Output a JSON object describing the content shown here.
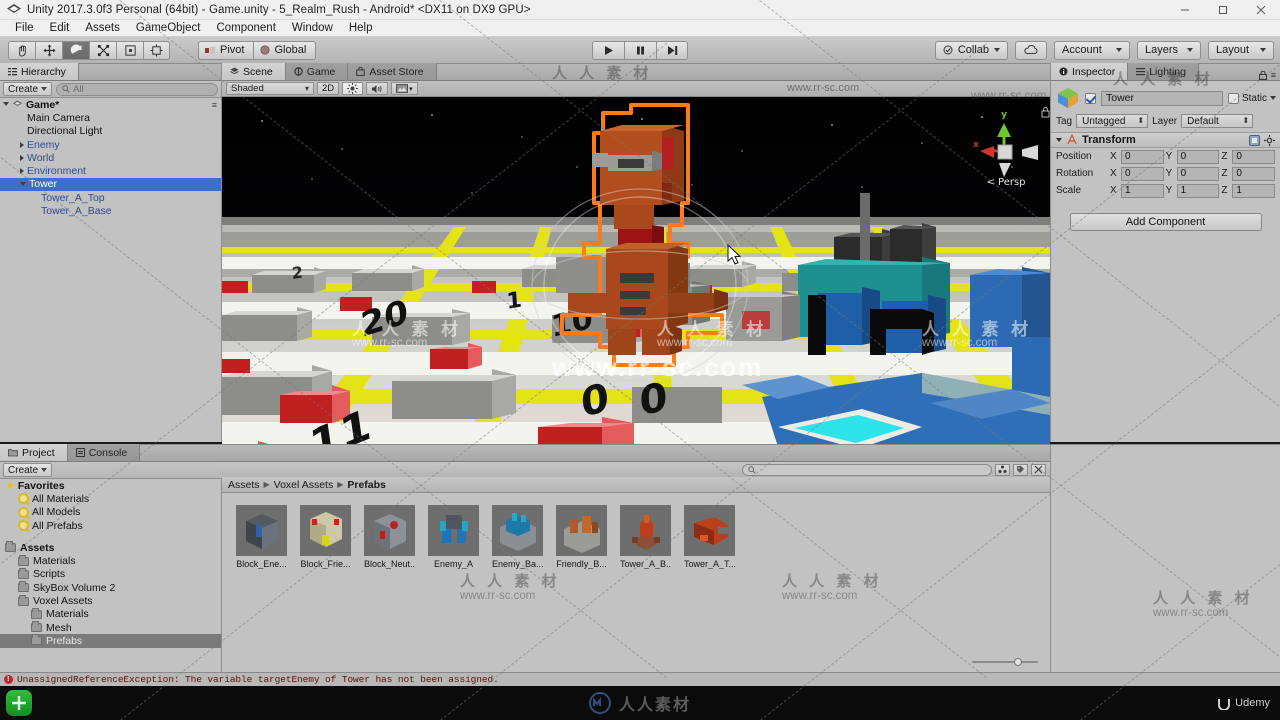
{
  "window": {
    "title": "Unity 2017.3.0f3 Personal (64bit) - Game.unity - 5_Realm_Rush - Android* <DX11 on DX9 GPU>",
    "icon": "unity-icon",
    "minimize": "–",
    "maximize": "❐",
    "close": "✕"
  },
  "menu": [
    "File",
    "Edit",
    "Assets",
    "GameObject",
    "Component",
    "Window",
    "Help"
  ],
  "toolbar": {
    "tools": [
      {
        "name": "hand-tool",
        "active": false
      },
      {
        "name": "move-tool",
        "active": false
      },
      {
        "name": "rotate-tool",
        "active": true
      },
      {
        "name": "scale-tool",
        "active": false
      },
      {
        "name": "rect-tool",
        "active": false
      },
      {
        "name": "transform-tool",
        "active": false
      }
    ],
    "pivot_label": "Pivot",
    "global_label": "Global",
    "play_label": "play",
    "pause_label": "pause",
    "step_label": "step",
    "collab_label": "Collab",
    "cloud_label": "cloud",
    "account_label": "Account",
    "layers_label": "Layers",
    "layout_label": "Layout"
  },
  "hierarchy": {
    "tab": "Hierarchy",
    "create_label": "Create",
    "search_placeholder": "All",
    "root": "Game*",
    "items": [
      {
        "label": "Main Camera",
        "indent": 1,
        "arrow": "none",
        "prefab": false,
        "selected": false
      },
      {
        "label": "Directional Light",
        "indent": 1,
        "arrow": "none",
        "prefab": false,
        "selected": false
      },
      {
        "label": "Enemy",
        "indent": 1,
        "arrow": "closed",
        "prefab": true,
        "selected": false
      },
      {
        "label": "World",
        "indent": 1,
        "arrow": "closed",
        "prefab": true,
        "selected": false
      },
      {
        "label": "Environment",
        "indent": 1,
        "arrow": "closed",
        "prefab": true,
        "selected": false
      },
      {
        "label": "Tower",
        "indent": 1,
        "arrow": "open",
        "prefab": true,
        "selected": true
      },
      {
        "label": "Tower_A_Top",
        "indent": 2,
        "arrow": "none",
        "prefab": true,
        "selected": false
      },
      {
        "label": "Tower_A_Base",
        "indent": 2,
        "arrow": "none",
        "prefab": true,
        "selected": false
      }
    ]
  },
  "scene": {
    "tabs": [
      {
        "label": "Scene",
        "icon": "scene-icon",
        "active": true
      },
      {
        "label": "Game",
        "icon": "game-icon",
        "active": false
      },
      {
        "label": "Asset Store",
        "icon": "store-icon",
        "active": false
      }
    ],
    "shading_mode": "Shaded",
    "two_d_label": "2D",
    "light_icon": "lighting-icon",
    "audio_icon": "audio-icon",
    "effects_icon": "effects-icon",
    "gizmo_labels": {
      "x": "x",
      "y": "y",
      "persp": "Persp"
    }
  },
  "inspector": {
    "tabs": [
      {
        "label": "Inspector",
        "icon": "inspector-icon",
        "active": true
      },
      {
        "label": "Lighting",
        "icon": "lighting-tab-icon",
        "active": false
      }
    ],
    "object_name": "Tower",
    "enabled": true,
    "static_label": "Static",
    "static_checked": false,
    "tag_label": "Tag",
    "tag_value": "Untagged",
    "layer_label": "Layer",
    "layer_value": "Default",
    "component": {
      "title": "Transform",
      "rows": [
        {
          "label": "Position",
          "x": "0",
          "y": "0",
          "z": "0"
        },
        {
          "label": "Rotation",
          "x": "0",
          "y": "0",
          "z": "0"
        },
        {
          "label": "Scale",
          "x": "1",
          "y": "1",
          "z": "1"
        }
      ],
      "axes": {
        "x": "X",
        "y": "Y",
        "z": "Z"
      }
    },
    "add_component_label": "Add Component"
  },
  "project": {
    "tabs": [
      {
        "label": "Project",
        "icon": "project-icon",
        "active": true
      },
      {
        "label": "Console",
        "icon": "console-icon",
        "active": false
      }
    ],
    "create_label": "Create",
    "tree": [
      {
        "label": "Favorites",
        "indent": 0,
        "arrow": "open",
        "icon": "star-icon",
        "bold": true,
        "selected": false
      },
      {
        "label": "All Materials",
        "indent": 1,
        "arrow": "none",
        "icon": "search-icon",
        "bold": false,
        "selected": false
      },
      {
        "label": "All Models",
        "indent": 1,
        "arrow": "none",
        "icon": "search-icon",
        "bold": false,
        "selected": false
      },
      {
        "label": "All Prefabs",
        "indent": 1,
        "arrow": "none",
        "icon": "search-icon",
        "bold": false,
        "selected": false
      },
      {
        "label": "",
        "indent": 0,
        "arrow": "none",
        "icon": "none",
        "bold": false,
        "selected": false
      },
      {
        "label": "Assets",
        "indent": 0,
        "arrow": "open",
        "icon": "folder-icon",
        "bold": true,
        "selected": false
      },
      {
        "label": "Materials",
        "indent": 1,
        "arrow": "none",
        "icon": "folder-icon",
        "bold": false,
        "selected": false
      },
      {
        "label": "Scripts",
        "indent": 1,
        "arrow": "none",
        "icon": "folder-icon",
        "bold": false,
        "selected": false
      },
      {
        "label": "SkyBox Volume 2",
        "indent": 1,
        "arrow": "closed",
        "icon": "folder-icon",
        "bold": false,
        "selected": false
      },
      {
        "label": "Voxel Assets",
        "indent": 1,
        "arrow": "open",
        "icon": "folder-icon",
        "bold": false,
        "selected": false
      },
      {
        "label": "Materials",
        "indent": 2,
        "arrow": "none",
        "icon": "folder-icon",
        "bold": false,
        "selected": false
      },
      {
        "label": "Mesh",
        "indent": 2,
        "arrow": "none",
        "icon": "folder-icon",
        "bold": false,
        "selected": false
      },
      {
        "label": "Prefabs",
        "indent": 2,
        "arrow": "none",
        "icon": "folder-icon",
        "bold": false,
        "selected": true
      }
    ],
    "breadcrumbs": [
      "Assets",
      "Voxel Assets",
      "Prefabs"
    ],
    "search_placeholder": "",
    "assets": [
      {
        "label": "Block_Ene...",
        "thumb": "block-enemy"
      },
      {
        "label": "Block_Frie...",
        "thumb": "block-friendly"
      },
      {
        "label": "Block_Neut...",
        "thumb": "block-neutral"
      },
      {
        "label": "Enemy_A",
        "thumb": "enemy-a"
      },
      {
        "label": "Enemy_Ba...",
        "thumb": "enemy-base"
      },
      {
        "label": "Friendly_B...",
        "thumb": "friendly-base"
      },
      {
        "label": "Tower_A_B...",
        "thumb": "tower-a-base"
      },
      {
        "label": "Tower_A_T...",
        "thumb": "tower-a-top"
      }
    ]
  },
  "status_bar": {
    "message": "UnassignedReferenceException: The variable targetEnemy of Tower has not been assigned.",
    "icon": "error-icon"
  },
  "taskbar": {
    "start_icon": "green-app-icon",
    "center_icon": "watermark-logo",
    "center_text": "人人素材",
    "udemy_label": "Udemy"
  },
  "watermarks": {
    "cn": "人 人 素 材",
    "url": "www.rr-sc.com"
  },
  "colors": {
    "selection_blue": "#3a6fce",
    "selection_outline": "#ff7a18",
    "panel_gray": "#c2c2c2",
    "toolbar_gray": "#b4b4b4",
    "error_red": "#c7242a"
  }
}
